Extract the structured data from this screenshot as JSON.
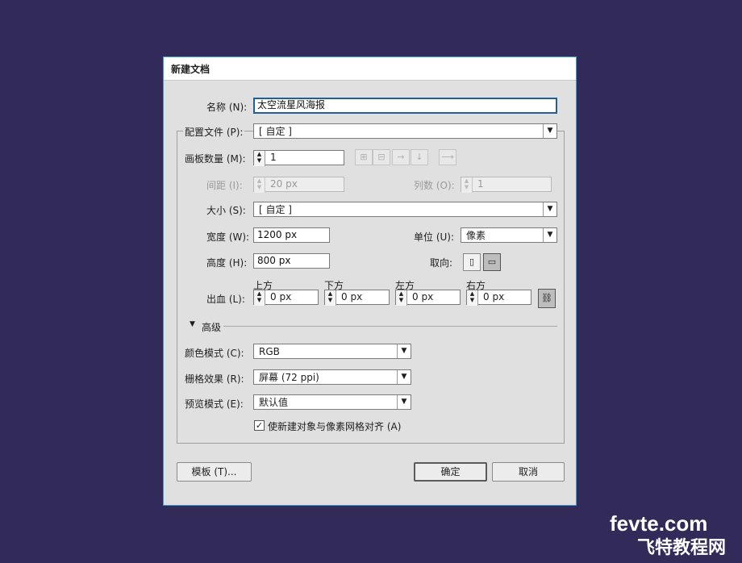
{
  "dialog": {
    "title": "新建文档",
    "name_label": "名称 (N):",
    "name_value": "太空流星风海报",
    "profile_label": "配置文件 (P):",
    "profile_value": "[ 自定 ]",
    "artboards_label": "画板数量 (M):",
    "artboards_value": "1",
    "spacing_label": "间距 (I):",
    "spacing_value": "20 px",
    "columns_label": "列数 (O):",
    "columns_value": "1",
    "size_label": "大小 (S):",
    "size_value": "[ 自定 ]",
    "width_label": "宽度 (W):",
    "width_value": "1200 px",
    "units_label": "单位 (U):",
    "units_value": "像素",
    "height_label": "高度 (H):",
    "height_value": "800 px",
    "orientation_label": "取向:",
    "bleed_label": "出血 (L):",
    "bleed": [
      {
        "label": "上方",
        "value": "0 px"
      },
      {
        "label": "下方",
        "value": "0 px"
      },
      {
        "label": "左方",
        "value": "0 px"
      },
      {
        "label": "右方",
        "value": "0 px"
      }
    ],
    "advanced_label": "高级",
    "color_mode_label": "颜色模式 (C):",
    "color_mode_value": "RGB",
    "raster_label": "栅格效果 (R):",
    "raster_value": "屏幕 (72 ppi)",
    "preview_label": "预览模式 (E):",
    "preview_value": "默认值",
    "align_checkbox_label": "使新建对象与像素网格对齐 (A)",
    "align_checked": true,
    "templates_button": "模板 (T)...",
    "ok_button": "确定",
    "cancel_button": "取消"
  },
  "watermark": {
    "line1": "fevte.com",
    "line2": "飞特教程网"
  },
  "colors": {
    "background": "#322a58",
    "dialog_bg": "#e0e0e0",
    "dialog_border": "#3aa0c9",
    "focus_border": "#1f5f9e"
  }
}
